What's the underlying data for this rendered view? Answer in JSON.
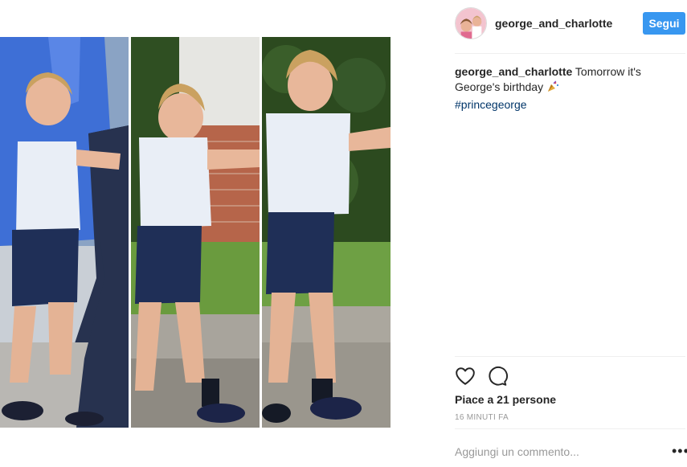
{
  "post": {
    "username": "george_and_charlotte",
    "follow_label": "Segui",
    "caption_username": "george_and_charlotte",
    "caption_text": "Tomorrow it's George's birthday",
    "caption_emoji": "party-popper-icon",
    "hashtag": "#princegeorge",
    "likes": "Piace a 21 persone",
    "time": "16 MINUTI FA",
    "comment_placeholder": "Aggiungi un commento...",
    "more_label": "•••"
  },
  "icons": {
    "heart": "heart-icon",
    "comment": "comment-icon"
  },
  "colors": {
    "follow_button": "#3897f0",
    "hashtag": "#003569",
    "muted_text": "#999999",
    "divider": "#efefef"
  }
}
